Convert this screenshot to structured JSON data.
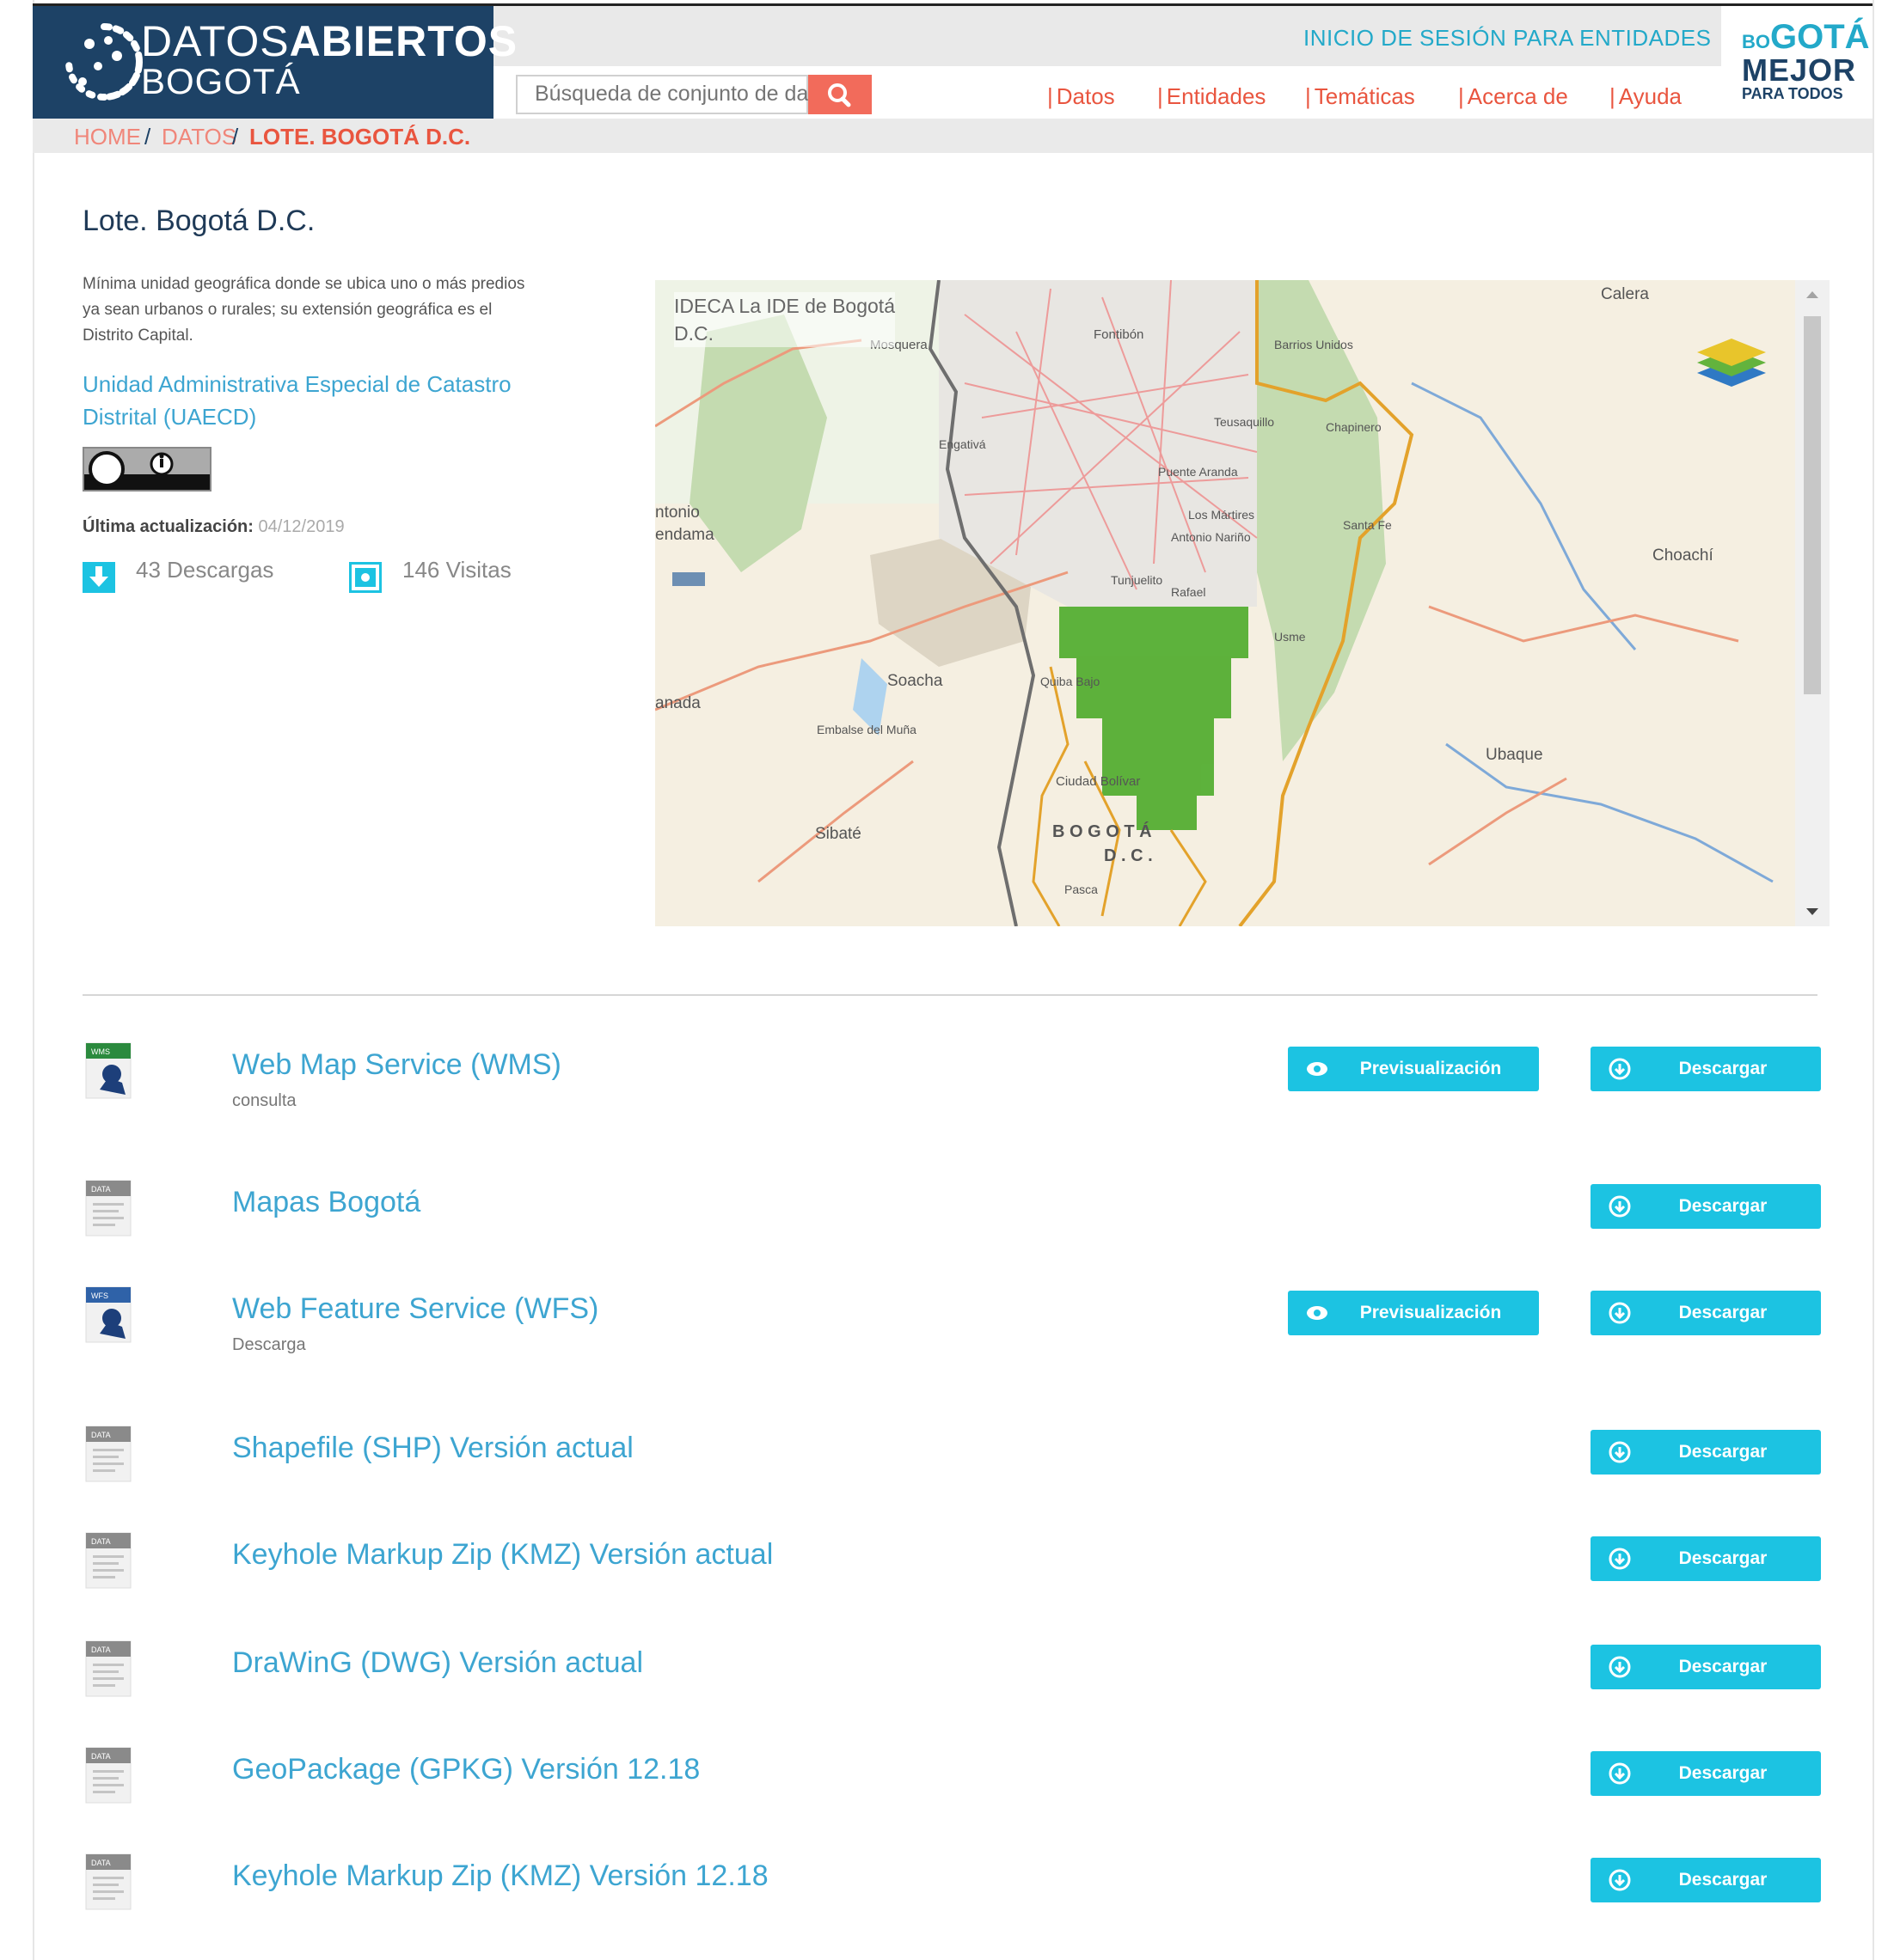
{
  "header": {
    "brand_line1_light": "DATOS",
    "brand_line1_bold": "ABIERTOS",
    "brand_line2": "BOGOTÁ",
    "login_link": "INICIO DE SESIÓN PARA ENTIDADES",
    "search_placeholder": "Búsqueda de conjunto de datos",
    "nav": [
      "Datos",
      "Entidades",
      "Temáticas",
      "Acerca de",
      "Ayuda"
    ],
    "right_logo": {
      "line1_small": "BO",
      "line1": "GOTÁ",
      "line2": "MEJOR",
      "line3": "PARA TODOS"
    },
    "colors": {
      "brand_bg": "#1d4266",
      "accent": "#e9553f",
      "teal": "#1cc3e2",
      "link": "#3da5d1"
    }
  },
  "breadcrumb": {
    "home": "HOME",
    "datos": "DATOS",
    "current": "LOTE. BOGOTÁ D.C.",
    "sep": "/"
  },
  "dataset": {
    "title": "Lote. Bogotá D.C.",
    "description": "Mínima unidad geográfica donde se ubica uno o más predios ya sean urbanos o rurales; su extensión geográfica es el Distrito Capital.",
    "organization": "Unidad Administrativa Especial de Catastro Distrital (UAECD)",
    "license_icon": "cc-by-icon",
    "updated_label": "Última actualización:",
    "updated_value": "04/12/2019",
    "downloads": "43 Descargas",
    "visits": "146 Visitas"
  },
  "map": {
    "attribution_line1": "IDECA La IDE de Bogotá",
    "attribution_line2": "D.C.",
    "labels": [
      "Calera",
      "Mosquera",
      "Fontibón",
      "Barrios Unidos",
      "Chapinero",
      "Engativá",
      "Teusaquillo",
      "Puente Aranda",
      "Los Mártires",
      "Santa Fe",
      "Antonio Nariño",
      "Tunjuelito",
      "Rafael",
      "Choachí",
      "Soacha",
      "Embalse del Muña",
      "Sibaté",
      "Ubaque",
      "Ciudad Bolívar",
      "B O G O T Á",
      "D . C .",
      "Pasca",
      "ntonio",
      "endama",
      "anada",
      "Quiba Bajo",
      "Usme"
    ]
  },
  "resources": [
    {
      "title": "Web Map Service (WMS)",
      "subtitle": "consulta",
      "icon": "wms-file-icon",
      "icon_tag": "WMS",
      "preview": true
    },
    {
      "title": "Mapas Bogotá",
      "subtitle": "",
      "icon": "data-file-icon",
      "icon_tag": "DATA",
      "preview": false
    },
    {
      "title": "Web Feature Service (WFS)",
      "subtitle": "Descarga",
      "icon": "wfs-file-icon",
      "icon_tag": "WFS",
      "preview": true
    },
    {
      "title": "Shapefile (SHP) Versión actual",
      "subtitle": "",
      "icon": "data-file-icon",
      "icon_tag": "DATA",
      "preview": false
    },
    {
      "title": "Keyhole Markup Zip (KMZ) Versión actual",
      "subtitle": "",
      "icon": "data-file-icon",
      "icon_tag": "DATA",
      "preview": false
    },
    {
      "title": "DraWinG (DWG) Versión actual",
      "subtitle": "",
      "icon": "data-file-icon",
      "icon_tag": "DATA",
      "preview": false
    },
    {
      "title": "GeoPackage (GPKG) Versión 12.18",
      "subtitle": "",
      "icon": "data-file-icon",
      "icon_tag": "DATA",
      "preview": false
    },
    {
      "title": "Keyhole Markup Zip (KMZ) Versión 12.18",
      "subtitle": "",
      "icon": "data-file-icon",
      "icon_tag": "DATA",
      "preview": false
    }
  ],
  "buttons": {
    "preview": "Previsualización",
    "download": "Descargar"
  }
}
